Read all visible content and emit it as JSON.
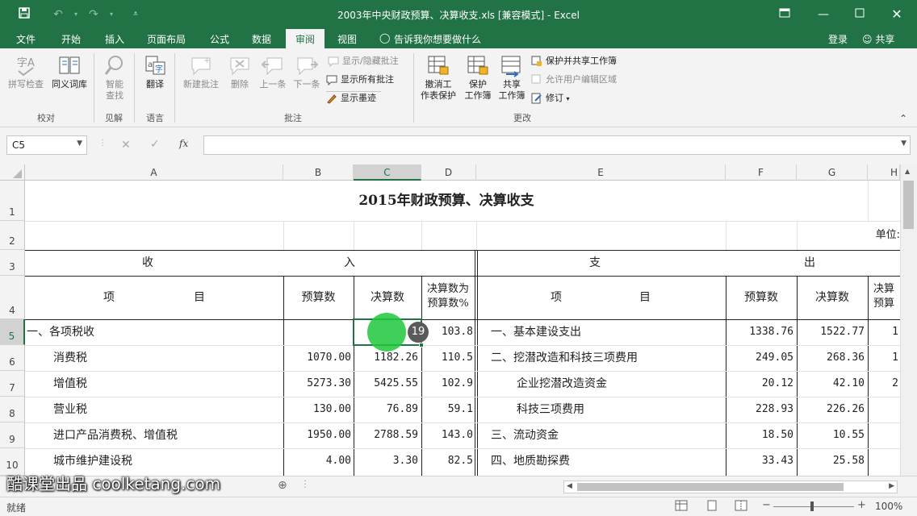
{
  "window": {
    "title": "2003年中央财政预算、决算收支.xls  [兼容模式] - Excel"
  },
  "menu": {
    "items": [
      "文件",
      "开始",
      "插入",
      "页面布局",
      "公式",
      "数据",
      "审阅",
      "视图"
    ],
    "active": "审阅",
    "tell_me": "告诉我你想要做什么",
    "login": "登录",
    "share": "共享"
  },
  "ribbon": {
    "proofing": {
      "spell": "拼写检查",
      "thesaurus": "同义词库",
      "group": "校对"
    },
    "insights": {
      "smart": "智能",
      "lookup": "查找",
      "group": "见解"
    },
    "language": {
      "translate": "翻译",
      "group": "语言"
    },
    "comments": {
      "new": "新建批注",
      "delete": "删除",
      "prev": "上一条",
      "next": "下一条",
      "show_hide": "显示/隐藏批注",
      "show_all": "显示所有批注",
      "show_ink": "显示墨迹",
      "group": "批注"
    },
    "changes": {
      "unprotect_l1": "撤消工",
      "unprotect_l2": "作表保护",
      "protect_l1": "保护",
      "protect_l2": "工作簿",
      "share_l1": "共享",
      "share_l2": "工作簿",
      "protect_share": "保护并共享工作簿",
      "allow_edit": "允许用户编辑区域",
      "track": "修订",
      "group": "更改"
    }
  },
  "formula_bar": {
    "name_box": "C5",
    "fx": "fx",
    "formula": ""
  },
  "columns": [
    "A",
    "B",
    "C",
    "D",
    "E",
    "F",
    "G",
    "H"
  ],
  "selected_column": "C",
  "rows": [
    "1",
    "2",
    "3",
    "4",
    "5",
    "6",
    "7",
    "8",
    "9",
    "10"
  ],
  "selected_row": "5",
  "sheet": {
    "title": "2015年财政预算、决算收支",
    "unit": "单位:",
    "income": "收",
    "income2": "入",
    "expense": "支",
    "expense2": "出",
    "hdr_item": "项",
    "hdr_item2": "目",
    "hdr_budget": "预算数",
    "hdr_final": "决算数",
    "hdr_ratio_l1": "决算数为",
    "hdr_ratio_l2": "预算数%",
    "hdr_ratio2_l1": "决算",
    "hdr_ratio2_l2": "预算",
    "data": [
      {
        "a": "一、各项税收",
        "b": "",
        "c": "",
        "d": "103.8",
        "e": "一、基本建设支出",
        "f": "1338.76",
        "g": "1522.77",
        "h": "1"
      },
      {
        "a": "消费税",
        "b": "1070.00",
        "c": "1182.26",
        "d": "110.5",
        "e": "二、挖潜改造和科技三项费用",
        "f": "249.05",
        "g": "268.36",
        "h": "1"
      },
      {
        "a": "增值税",
        "b": "5273.30",
        "c": "5425.55",
        "d": "102.9",
        "e": "企业挖潜改造资金",
        "f": "20.12",
        "g": "42.10",
        "h": "2"
      },
      {
        "a": "营业税",
        "b": "130.00",
        "c": "76.89",
        "d": "59.1",
        "e": "科技三项费用",
        "f": "228.93",
        "g": "226.26",
        "h": ""
      },
      {
        "a": "进口产品消费税、增值税",
        "b": "1950.00",
        "c": "2788.59",
        "d": "143.0",
        "e": "三、流动资金",
        "f": "18.50",
        "g": "10.55",
        "h": ""
      },
      {
        "a": "城市维护建设税",
        "b": "4.00",
        "c": "3.30",
        "d": "82.5",
        "e": "四、地质勘探费",
        "f": "33.43",
        "g": "25.58",
        "h": ""
      }
    ]
  },
  "click_marker": "19",
  "status": {
    "ready": "就绪",
    "zoom": "100%"
  },
  "watermark": "酷课堂出品 coolketang.com"
}
